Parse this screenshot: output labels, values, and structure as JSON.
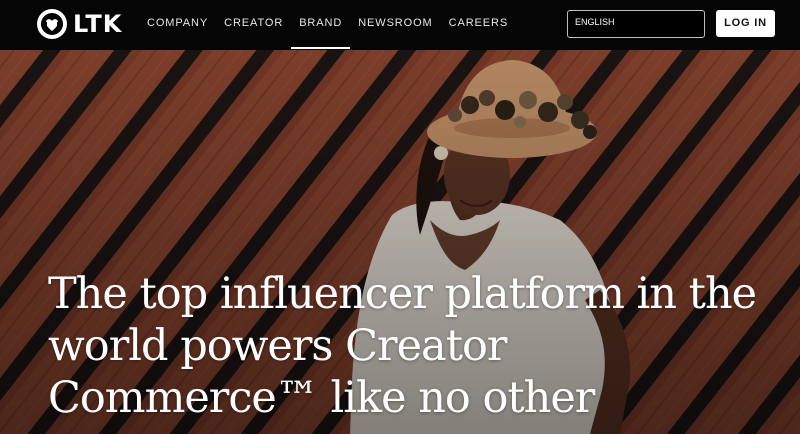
{
  "brand": {
    "name": "LTK",
    "logo_icon": "ltk-heart-logo-icon"
  },
  "nav": {
    "items": [
      {
        "label": "COMPANY",
        "active": false
      },
      {
        "label": "CREATOR",
        "active": false
      },
      {
        "label": "BRAND",
        "active": true
      },
      {
        "label": "NEWSROOM",
        "active": false
      },
      {
        "label": "CAREERS",
        "active": false
      }
    ],
    "language": "ENGLISH",
    "login_label": "LOG IN"
  },
  "hero": {
    "headline": "The top influencer platform in the world powers Creator Commerce™ like no other"
  },
  "colors": {
    "nav_bg": "#050505",
    "wall_wood": "#7a3a28",
    "wall_stripe": "#1b1413",
    "text": "#ffffff"
  }
}
